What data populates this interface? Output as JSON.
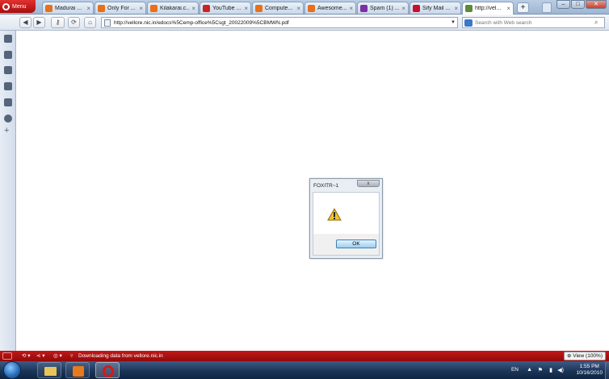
{
  "browser": {
    "menu_label": "Menu",
    "tabs": [
      {
        "label": "Madurai ...",
        "favicon_color": "#e8701a"
      },
      {
        "label": "Only For ...",
        "favicon_color": "#e8701a"
      },
      {
        "label": "Kilakarai.c...",
        "favicon_color": "#e8701a"
      },
      {
        "label": "YouTube ...",
        "favicon_color": "#cc2222"
      },
      {
        "label": "Compute...",
        "favicon_color": "#e8701a"
      },
      {
        "label": "Awesome...",
        "favicon_color": "#e8701a"
      },
      {
        "label": "Spam (1) ...",
        "favicon_color": "#7b2fa6"
      },
      {
        "label": "Sify Mail ...",
        "favicon_color": "#c8102e"
      },
      {
        "label": "http://vel...",
        "favicon_color": "#5a8a3a"
      }
    ],
    "new_tab_label": "+",
    "address_url": "http://vellore.nic.in/edocs%5Cemp-office%5Csgt_20022009%5CBMWN.pdf",
    "search_placeholder": "Search with Web search"
  },
  "dialog": {
    "title": "FOXITR~1",
    "close_label": "x",
    "ok_label": "OK"
  },
  "statusbar": {
    "status_text": "Downloading data from vellore.nic.in",
    "zoom_text": "View (100%)"
  },
  "taskbar": {
    "language": "EN",
    "time": "1:55 PM",
    "date": "10/16/2010"
  },
  "colors": {
    "opera_red": "#c51818",
    "taskbar_blue": "#1b3558"
  }
}
